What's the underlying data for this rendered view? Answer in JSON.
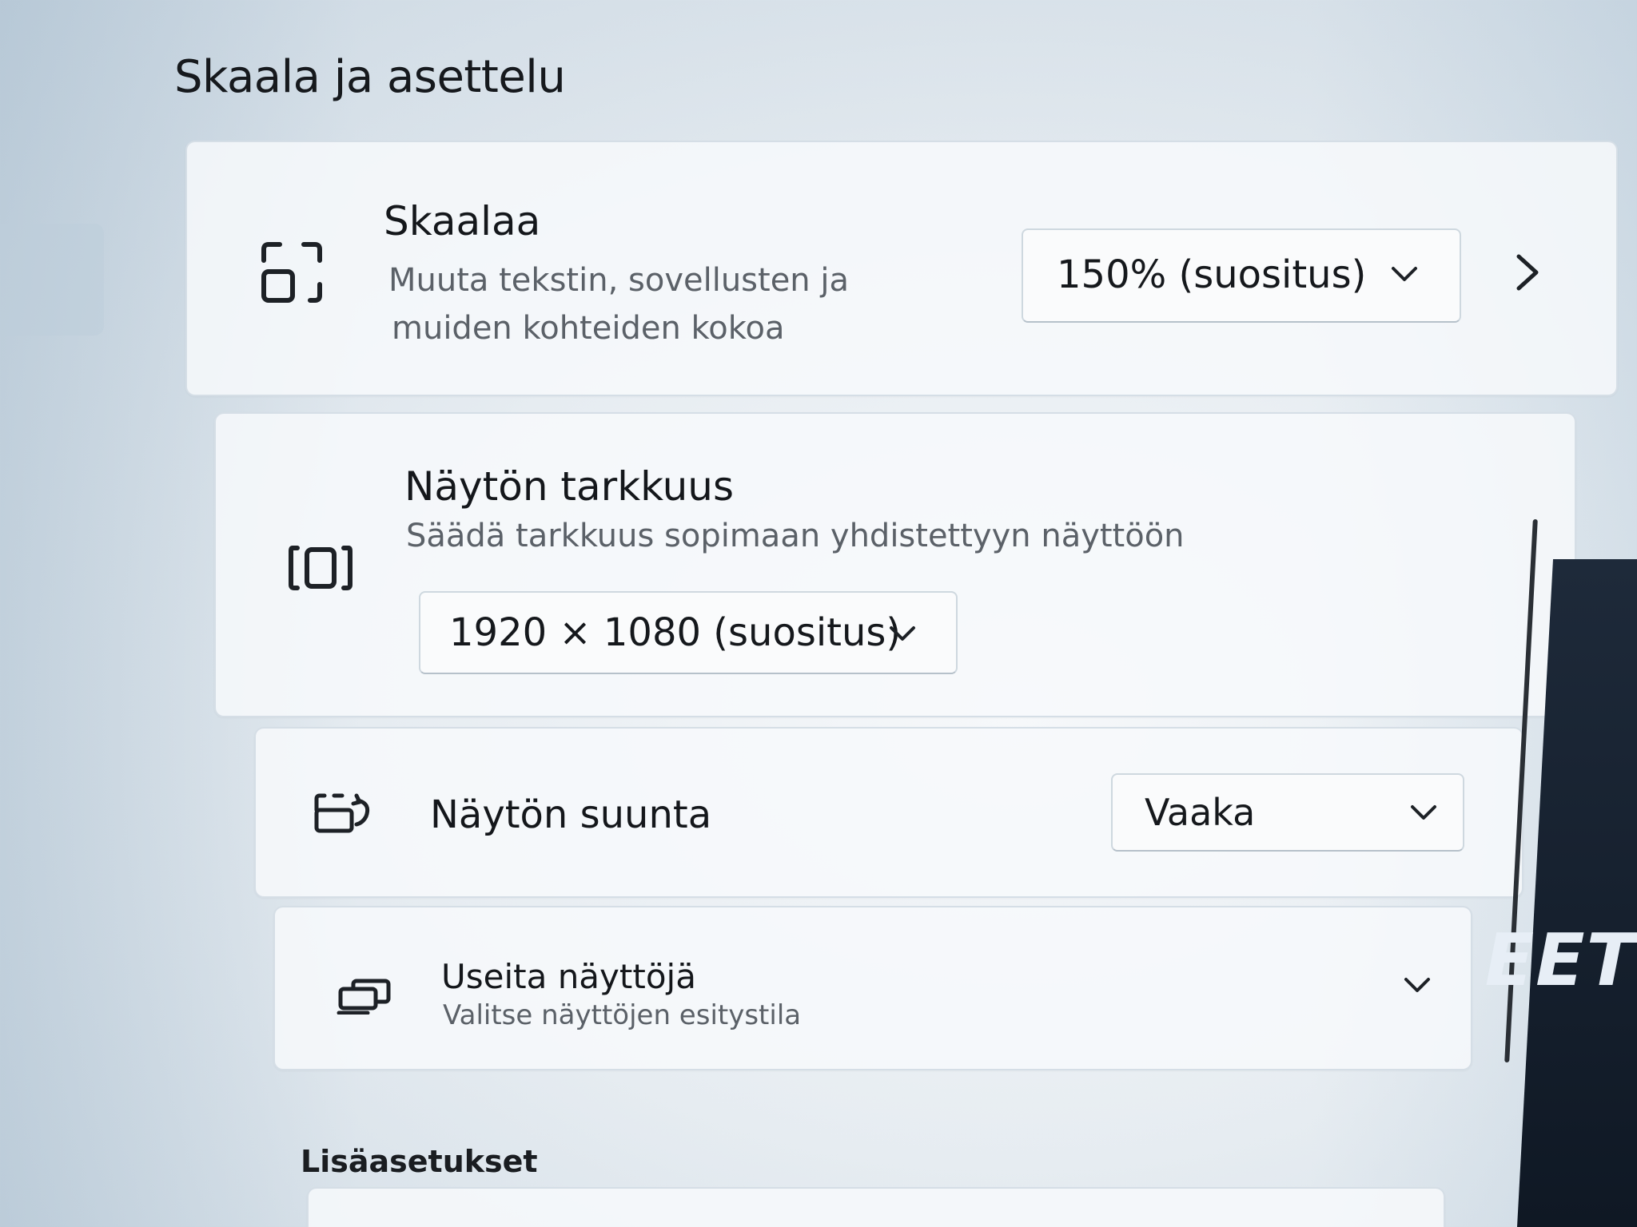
{
  "section": {
    "title": "Skaala ja asettelu"
  },
  "scale": {
    "icon": "scale-icon",
    "title": "Skaalaa",
    "description_line1": "Muuta tekstin, sovellusten ja",
    "description_line2": "muiden kohteiden kokoa",
    "selected": "150% (suositus)",
    "chevron_icon": "chevron-down-icon",
    "more_icon": "chevron-right-icon"
  },
  "resolution": {
    "icon": "resolution-icon",
    "title": "Näytön tarkkuus",
    "description": "Säädä tarkkuus sopimaan yhdistettyyn näyttöön",
    "selected": "1920 × 1080 (suositus)",
    "chevron_icon": "chevron-down-icon"
  },
  "orientation": {
    "icon": "orientation-icon",
    "title": "Näytön suunta",
    "selected": "Vaaka",
    "chevron_icon": "chevron-down-icon"
  },
  "multiple_displays": {
    "icon": "multiple-displays-icon",
    "title": "Useita näyttöjä",
    "description": "Valitse näyttöjen esitystila",
    "expand_icon": "chevron-down-icon"
  },
  "more_settings": {
    "title": "Lisäasetukset"
  },
  "edge_text": "EET",
  "colors": {
    "background": "#e6ecf1",
    "card": "#f7f9fb",
    "text": "#16191d",
    "secondary_text": "#5b6168"
  }
}
